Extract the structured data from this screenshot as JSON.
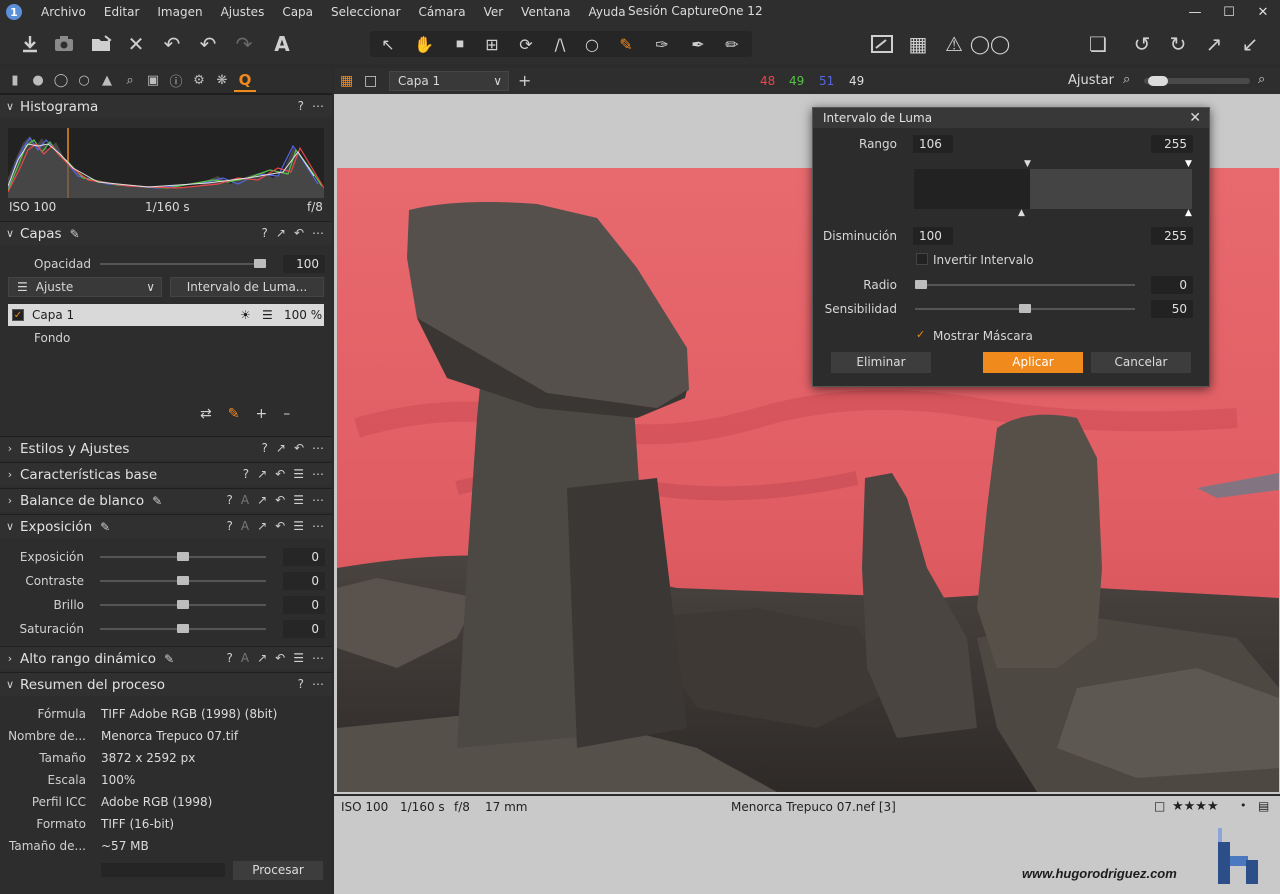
{
  "menubar": {
    "items": [
      "Archivo",
      "Editar",
      "Imagen",
      "Ajustes",
      "Capa",
      "Seleccionar",
      "Cámara",
      "Ver",
      "Ventana",
      "Ayuda"
    ],
    "title": "Sesión CaptureOne 12",
    "app_icon": "1"
  },
  "viewer_toolbar": {
    "layer_select": "Capa 1",
    "rgb": {
      "r": "48",
      "g": "49",
      "b": "51",
      "l": "49"
    },
    "fit_label": "Ajustar",
    "zoom_fraction": 0.05
  },
  "histogram": {
    "title": "Histograma",
    "iso": "ISO 100",
    "shutter": "1/160 s",
    "aperture": "f/8"
  },
  "layers": {
    "title": "Capas",
    "opacity_label": "Opacidad",
    "opacity_value": "100",
    "opacity_fraction": 1.0,
    "adjust_label": "Ajuste",
    "luma_button": "Intervalo de Luma...",
    "items": [
      {
        "name": "Capa 1",
        "opacity": "100 %",
        "checked": true
      },
      {
        "name": "Fondo"
      }
    ]
  },
  "sections": {
    "estilos": "Estilos y Ajustes",
    "caracteristicas": "Características base",
    "balance": "Balance de blanco",
    "exposicion": "Exposición",
    "alto_rango": "Alto rango dinámico",
    "resumen": "Resumen del proceso"
  },
  "exposure": {
    "rows": [
      {
        "label": "Exposición",
        "value": "0",
        "fraction": 0.5
      },
      {
        "label": "Contraste",
        "value": "0",
        "fraction": 0.5
      },
      {
        "label": "Brillo",
        "value": "0",
        "fraction": 0.5
      },
      {
        "label": "Saturación",
        "value": "0",
        "fraction": 0.5
      }
    ]
  },
  "summary": {
    "rows": [
      {
        "label": "Fórmula",
        "value": "TIFF Adobe RGB (1998) (8bit)"
      },
      {
        "label": "Nombre de...",
        "value": "Menorca Trepuco 07.tif"
      },
      {
        "label": "Tamaño",
        "value": "3872 x 2592 px"
      },
      {
        "label": "Escala",
        "value": "100%"
      },
      {
        "label": "Perfil ICC",
        "value": "Adobe RGB (1998)"
      },
      {
        "label": "Formato",
        "value": "TIFF (16-bit)"
      },
      {
        "label": "Tamaño de...",
        "value": "~57 MB"
      }
    ],
    "process_button": "Procesar"
  },
  "viewer_status": {
    "iso": "ISO 100",
    "shutter": "1/160 s",
    "aperture": "f/8",
    "focal": "17 mm",
    "filename": "Menorca Trepuco 07.nef [3]",
    "stars": "★★★★",
    "watermark": "www.hugorodriguez.com"
  },
  "luma_dialog": {
    "title": "Intervalo de Luma",
    "range_label": "Rango",
    "range_low": "106",
    "range_high": "255",
    "falloff_label": "Disminución",
    "falloff_low": "100",
    "falloff_high": "255",
    "invert_label": "Invertir Intervalo",
    "invert_checked": false,
    "radius_label": "Radio",
    "radius_value": "0",
    "radius_fraction": 0.0,
    "sensitivity_label": "Sensibilidad",
    "sensitivity_value": "50",
    "sensitivity_fraction": 0.5,
    "show_mask_label": "Mostrar Máscara",
    "show_mask_checked": true,
    "delete_button": "Eliminar",
    "apply_button": "Aplicar",
    "cancel_button": "Cancelar"
  },
  "colors": {
    "accent": "#f08a1c",
    "mask_overlay": "#e8666a",
    "r": "#e8474b",
    "g": "#55c245",
    "b": "#5566e6"
  }
}
